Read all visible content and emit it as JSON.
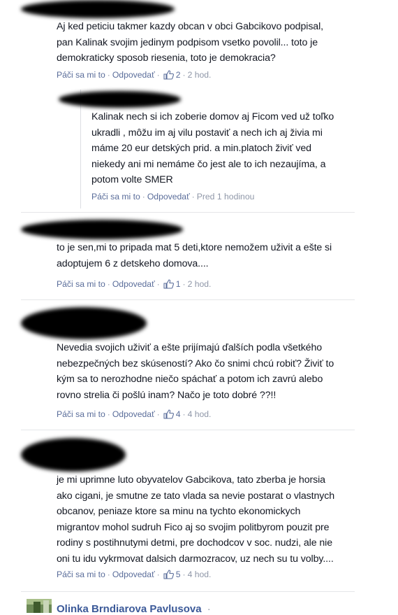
{
  "comments": [
    {
      "text": "Aj ked peticiu takmer kazdy obcan v obci Gabcikovo podpisal, pan Kalinak svojim jedinym podpisom vsetko povolil... toto je demokraticky sposob riesenia, toto je demokracia?",
      "lines": [
        "Aj ked peticiu takmer kazdy obcan v obci Gabcikovo podpisal,",
        "pan Kalinak svojim jedinym podpisom vsetko povolil... toto je",
        "demokraticky sposob riesenia, toto je demokracia?"
      ],
      "like_label": "Páči sa mi to",
      "reply_label": "Odpovedať",
      "likes": "2",
      "time": "2 hod."
    },
    {
      "text": "Kalinak nech si ich zoberie domov aj Ficom ved už toľko ukradli , môžu im aj vilu postaviť a nech ich aj živia mi máme 20 eur detských prid. a min.platoch živiť ved niekedy ani mi nemáme čo jest ale to ich nezaujíma, a potom volte SMER",
      "lines": [
        "Kalinak nech si ich zoberie domov aj Ficom ved už toľko",
        "ukradli , môžu im aj vilu postaviť a nech ich aj živia mi",
        "máme 20 eur detských prid. a min.platoch živiť ved",
        "niekedy ani mi nemáme čo jest ale to ich nezaujíma, a",
        "potom volte SMER"
      ],
      "like_label": "Páči sa mi to",
      "reply_label": "Odpovedať",
      "time": "Pred 1 hodinou"
    },
    {
      "text": "to je sen,mi to pripada mat 5 deti,ktore nemožem uživit a ešte si adoptujem 6 z detskeho domova....",
      "lines": [
        "to je sen,mi to pripada mat 5 deti,ktore nemožem uživit a ešte si",
        "adoptujem 6 z detskeho domova...."
      ],
      "like_label": "Páči sa mi to",
      "reply_label": "Odpovedať",
      "likes": "1",
      "time": "2 hod."
    },
    {
      "text": "Nevedia svojich uživiť a ešte prijímajú ďalších podla všetkého nebezpečných bez skúseností? Ako čo snimi chcú robiť? Živiť to kým sa to nerozhodne niečo spáchať a potom ich zavrú alebo rovno strelia či pošlú inam? Načo je toto dobré ??!!",
      "lines": [
        "Nevedia svojich uživiť a ešte prijímajú ďalších podla všetkého",
        "nebezpečných bez skúseností? Ako čo snimi chcú robiť? Živiť to",
        "kým sa to nerozhodne niečo spáchať a potom ich zavrú alebo",
        "rovno strelia či pošlú inam? Načo je toto dobré ??!!"
      ],
      "like_label": "Páči sa mi to",
      "reply_label": "Odpovedať",
      "likes": "4",
      "time": "4 hod."
    },
    {
      "text": "je mi uprimne luto obyvatelov Gabcikova, tato zberba je horsia ako cigani, je smutne ze tato vlada sa nevie postarat o vlastnych obcanov, peniaze ktore sa minu na tychto ekonomickych migrantov mohol sudruh Fico aj so svojim politbyrom pouzit pre rodiny s postihnutymi detmi, pre dochodcov v soc. nudzi, ale nie oni tu idu vykrmovat dalsich darmozracov, uz nech su tu volby....",
      "lines": [
        "je mi uprimne luto obyvatelov Gabcikova, tato zberba je horsia",
        "ako cigani, je smutne ze tato vlada sa nevie postarat o vlastnych",
        "obcanov, peniaze ktore sa minu na tychto ekonomickych",
        "migrantov mohol sudruh Fico aj so svojim politbyrom pouzit pre",
        "rodiny s postihnutymi detmi, pre dochodcov v soc. nudzi, ale nie",
        "oni tu idu vykrmovat dalsich darmozracov, uz nech su tu volby...."
      ],
      "like_label": "Páči sa mi to",
      "reply_label": "Odpovedať",
      "likes": "5",
      "time": "4 hod."
    }
  ],
  "next_comment": {
    "author": "Olinka Brndiarova Pavlusova",
    "suffix": "·"
  },
  "icons": {
    "like": "thumbs-up-icon",
    "avatar": "profile-picture"
  },
  "colors": {
    "link": "#5a6d9a",
    "meta": "#8f97a8",
    "author": "#3b5998",
    "divider": "#e5e6e9"
  }
}
